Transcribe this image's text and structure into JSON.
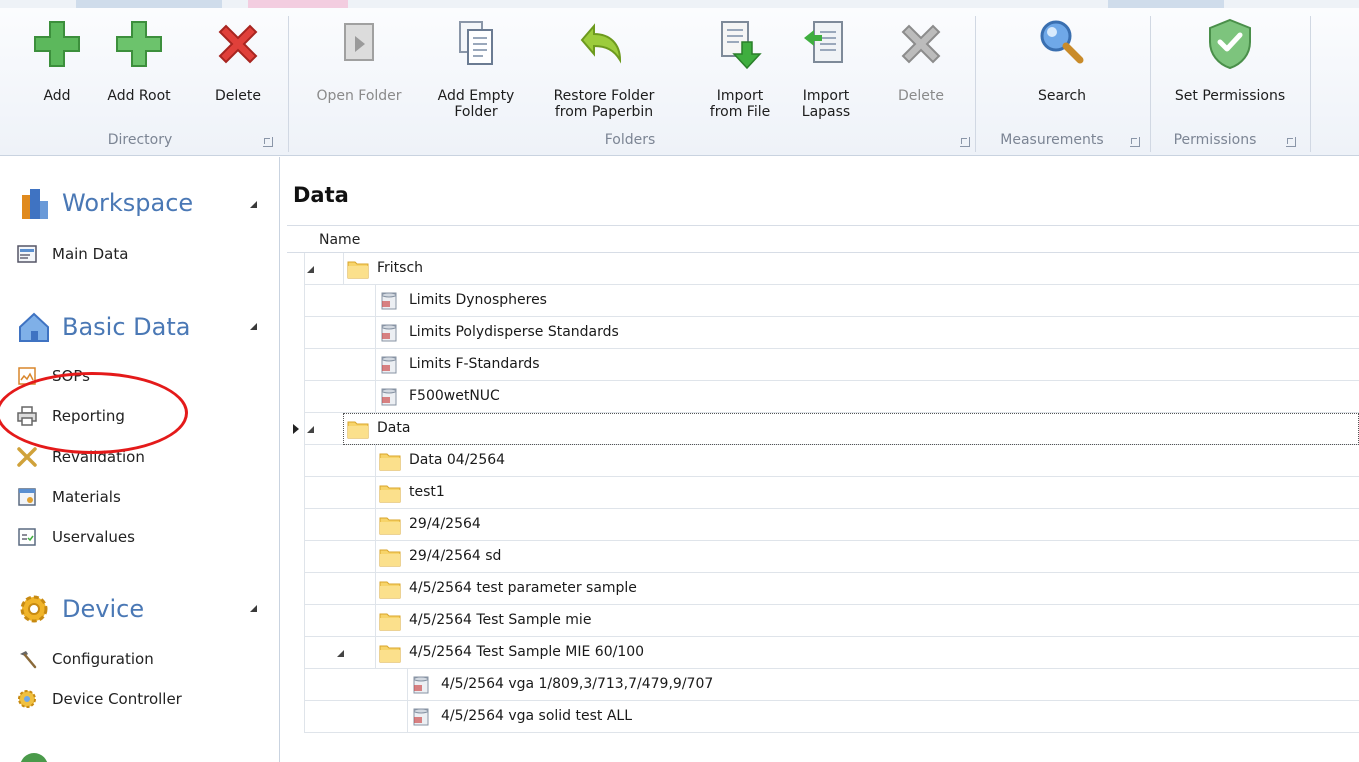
{
  "ribbon": {
    "groups": [
      {
        "label": "Directory",
        "buttons": [
          {
            "label": "Add",
            "icon": "plus-green-icon"
          },
          {
            "label": "Add Root",
            "icon": "plus-green-icon"
          },
          {
            "label": "Delete",
            "icon": "delete-red-x-icon"
          }
        ]
      },
      {
        "label": "Folders",
        "buttons": [
          {
            "label": "Open Folder",
            "icon": "open-folder-icon",
            "disabled": true
          },
          {
            "label": "Add Empty Folder",
            "icon": "add-folder-icon"
          },
          {
            "label": "Restore Folder from Paperbin",
            "icon": "restore-arrow-icon"
          },
          {
            "label": "Import from File",
            "icon": "import-file-icon"
          },
          {
            "label": "Import Lapass",
            "icon": "import-lapass-icon"
          },
          {
            "label": "Delete",
            "icon": "delete-gray-x-icon",
            "disabled": true
          }
        ]
      },
      {
        "label": "Measurements",
        "buttons": [
          {
            "label": "Search",
            "icon": "magnifier-icon"
          }
        ]
      },
      {
        "label": "Permissions",
        "buttons": [
          {
            "label": "Set Permissions",
            "icon": "shield-check-icon"
          }
        ]
      }
    ]
  },
  "sidebar": {
    "sections": [
      {
        "title": "Workspace",
        "icon": "workspace-icon",
        "items": [
          {
            "label": "Main Data",
            "icon": "main-data-icon"
          }
        ]
      },
      {
        "title": "Basic Data",
        "icon": "basic-data-house-icon",
        "items": [
          {
            "label": "SOPs",
            "icon": "sops-icon"
          },
          {
            "label": "Reporting",
            "icon": "printer-icon"
          },
          {
            "label": "Revalidation",
            "icon": "revalidation-icon"
          },
          {
            "label": "Materials",
            "icon": "materials-icon"
          },
          {
            "label": "Uservalues",
            "icon": "uservalues-icon"
          }
        ]
      },
      {
        "title": "Device",
        "icon": "device-gear-icon",
        "items": [
          {
            "label": "Configuration",
            "icon": "hammer-icon"
          },
          {
            "label": "Device Controller",
            "icon": "device-controller-icon"
          }
        ]
      }
    ]
  },
  "main": {
    "title": "Data",
    "column_name": "Name",
    "rows": [
      {
        "label": "Fritsch",
        "type": "folder",
        "level": 0,
        "expanded": true
      },
      {
        "label": "Limits  Dynospheres",
        "type": "db",
        "level": 1
      },
      {
        "label": "Limits Polydisperse Standards",
        "type": "db",
        "level": 1
      },
      {
        "label": "Limits F-Standards",
        "type": "db",
        "level": 1
      },
      {
        "label": "F500wetNUC",
        "type": "db",
        "level": 1
      },
      {
        "label": "Data",
        "type": "folder",
        "level": 0,
        "expanded": true,
        "current": true
      },
      {
        "label": "Data 04/2564",
        "type": "folder",
        "level": 1
      },
      {
        "label": "test1",
        "type": "folder",
        "level": 1
      },
      {
        "label": "29/4/2564",
        "type": "folder",
        "level": 1
      },
      {
        "label": "29/4/2564 sd",
        "type": "folder",
        "level": 1
      },
      {
        "label": "4/5/2564 test parameter sample",
        "type": "folder",
        "level": 1
      },
      {
        "label": "4/5/2564 Test Sample mie",
        "type": "folder",
        "level": 1
      },
      {
        "label": "4/5/2564 Test Sample MIE 60/100",
        "type": "folder",
        "level": 1,
        "expanded": true
      },
      {
        "label": "4/5/2564 vga 1/809,3/713,7/479,9/707",
        "type": "db",
        "level": 2
      },
      {
        "label": "4/5/2564 vga solid test ALL",
        "type": "db",
        "level": 2
      }
    ]
  },
  "colors": {
    "accent": "#4a78b5",
    "highlight_ring": "#e41a1a",
    "folder": "#f5c542"
  }
}
